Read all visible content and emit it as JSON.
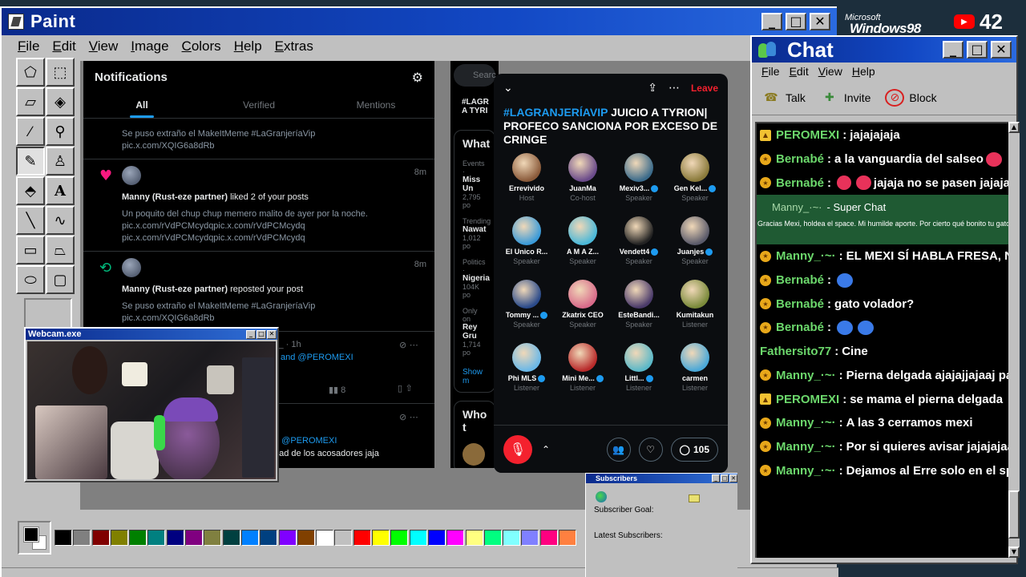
{
  "paint": {
    "title": "Paint",
    "menu": [
      "File",
      "Edit",
      "View",
      "Image",
      "Colors",
      "Help",
      "Extras"
    ],
    "tools": [
      "free-select",
      "rect-select",
      "eraser",
      "fill",
      "color-picker",
      "magnifier",
      "pencil",
      "brush",
      "airbrush",
      "text",
      "line",
      "curve",
      "rectangle",
      "polygon",
      "ellipse",
      "rounded-rect"
    ],
    "palette": [
      "#000000",
      "#808080",
      "#800000",
      "#808000",
      "#008000",
      "#008080",
      "#000080",
      "#800080",
      "#808040",
      "#004040",
      "#0080ff",
      "#004080",
      "#8000ff",
      "#804000",
      "#ffffff",
      "#c0c0c0",
      "#ff0000",
      "#ffff00",
      "#00ff00",
      "#00ffff",
      "#0000ff",
      "#ff00ff",
      "#ffff80",
      "#00ff80",
      "#80ffff",
      "#8080ff",
      "#ff0080",
      "#ff8040"
    ]
  },
  "twitter": {
    "header": "Notifications",
    "tabs": [
      "All",
      "Verified",
      "Mentions"
    ],
    "notif0": {
      "text": "Se puso extraño el MakeItMeme #LaGranjeríaVip",
      "link": "pic.x.com/XQIG6a8dRb"
    },
    "notif1": {
      "time": "8m",
      "who": "Manny (Rust-eze partner)",
      "action": " liked 2 of your posts",
      "line1": "Un poquito del chup chup memero malito de ayer por la noche.",
      "line2": "pic.x.com/rVdPCMcydqpic.x.com/rVdPCMcydq",
      "line3": "pic.x.com/rVdPCMcydqpic.x.com/rVdPCMcydq"
    },
    "notif2": {
      "time": "8m",
      "who": "Manny (Rust-eze partner)",
      "action": " reposted your post",
      "line1": "Se puso extraño el MakeItMeme #LaGranjeríaVip",
      "line2": "pic.x.com/XQIG6a8dRb"
    },
    "notif3": {
      "meta": "y_ · 1h",
      "mention": "and @PEROMEXI",
      "views": "8"
    },
    "notif4": {
      "mention": "d @PEROMEXI",
      "text": "dad de los acosadores jaja"
    },
    "right": {
      "search": "Searc",
      "item1": "#LAGR",
      "item1b": "A TYRI",
      "whats": "What",
      "events": "Events ·",
      "missun": "Miss Un",
      "posts1": "2,795 po",
      "trending": "Trending",
      "nawat": "Nawat",
      "posts2": "1,012 po",
      "politics": "Politics ·",
      "nigeria": "Nigeria",
      "posts3": "104K po",
      "onlyon": "Only on",
      "reygru": "Rey Gru",
      "posts4": "1,714 po",
      "showmore": "Show m",
      "who": "Who t"
    }
  },
  "spaces": {
    "leave": "Leave",
    "title_tag": "#LAGRANJERÍAVIP",
    "title_rest": " JUICIO A TYRION| PROFECO SANCIONA POR EXCESO DE CRINGE",
    "count": "105",
    "speakers": [
      {
        "name": "Errevivido",
        "role": "Host",
        "color": "#8a5a3a"
      },
      {
        "name": "JuanMa",
        "role": "Co-host",
        "color": "#6a4a8a"
      },
      {
        "name": "Mexiv3...",
        "role": "Speaker",
        "color": "#3a6a8a",
        "verified": true
      },
      {
        "name": "Gen Kel...",
        "role": "Speaker",
        "color": "#8a7a3a",
        "verified": true
      },
      {
        "name": "El Unico R...",
        "role": "Speaker",
        "color": "#3a9ad8"
      },
      {
        "name": "A M A Z...",
        "role": "Speaker",
        "color": "#4ab8d8"
      },
      {
        "name": "Vendett4",
        "role": "Speaker",
        "color": "#222222",
        "verified": true
      },
      {
        "name": "Juanjes",
        "role": "Speaker",
        "color": "#5a5a6a",
        "verified": true
      },
      {
        "name": "Tommy ...",
        "role": "Speaker",
        "color": "#2a4a8a",
        "verified": true
      },
      {
        "name": "Zkatrix CEO",
        "role": "Speaker",
        "color": "#d86a8a"
      },
      {
        "name": "EsteBandi...",
        "role": "Speaker",
        "color": "#4a3a6a"
      },
      {
        "name": "Kumitakun",
        "role": "Listener",
        "color": "#7a8a3a"
      },
      {
        "name": "Phi MLS",
        "role": "Listener",
        "color": "#6ab8e8",
        "verified": true
      },
      {
        "name": "Mini Me...",
        "role": "Listener",
        "color": "#b82a2a",
        "verified": true
      },
      {
        "name": "Littl...",
        "role": "Listener",
        "color": "#5ab8c8",
        "verified": true
      },
      {
        "name": "carmen",
        "role": "Listener",
        "color": "#4aa8d8"
      }
    ]
  },
  "webcam": {
    "title": "Webcam.exe"
  },
  "subscribers": {
    "title": "Subscribers",
    "goal": "Subscriber Goal:",
    "latest": "Latest Subscribers:"
  },
  "brand": {
    "microsoft": "Microsoft",
    "windows": "Windows98",
    "youtube_count": "42"
  },
  "chat": {
    "title": "Chat",
    "menu": [
      "File",
      "Edit",
      "View",
      "Help"
    ],
    "toolbar": [
      "Talk",
      "Invite",
      "Block"
    ],
    "superchat": {
      "name": "Manny_·~·",
      "label": "- Super Chat",
      "text": "Gracias Mexi, holdea el space. Mi humilde aporte. Por cierto qué bonito tu gato"
    },
    "messages": [
      {
        "author": "PEROMEXI",
        "text": "jajajajaja",
        "badge": "mod"
      },
      {
        "author": "Bernabé",
        "text": "a la vanguardia del salseo",
        "badge": "member",
        "emote": "#e8325a"
      },
      {
        "author": "Bernabé",
        "text": "jajaja no se pasen jajaja",
        "badge": "member",
        "emote": "#e8325a"
      },
      {
        "author": "Manny_·~·",
        "text": "EL MEXI SÍ HABLA FRESA, NO T",
        "badge": "member"
      },
      {
        "author": "Bernabé",
        "text": "",
        "badge": "member",
        "emote": "#3a7ae8"
      },
      {
        "author": "Bernabé",
        "text": "gato volador?",
        "badge": "member"
      },
      {
        "author": "Bernabé",
        "text": "",
        "badge": "member",
        "emote": "#3a7ae8"
      },
      {
        "author": "Fathersito77",
        "text": "Cine",
        "badge": "none"
      },
      {
        "author": "Manny_·~·",
        "text": "Pierna delgada ajajajjajaaj pare",
        "badge": "member"
      },
      {
        "author": "PEROMEXI",
        "text": "se mama el pierna delgada",
        "badge": "mod"
      },
      {
        "author": "Manny_·~·",
        "text": "A las 3 cerramos mexi",
        "badge": "member"
      },
      {
        "author": "Manny_·~·",
        "text": "Por si quieres avisar jajajajaa",
        "badge": "member"
      },
      {
        "author": "Manny_·~·",
        "text": "Dejamos al Erre solo en el spac",
        "badge": "member"
      }
    ]
  }
}
